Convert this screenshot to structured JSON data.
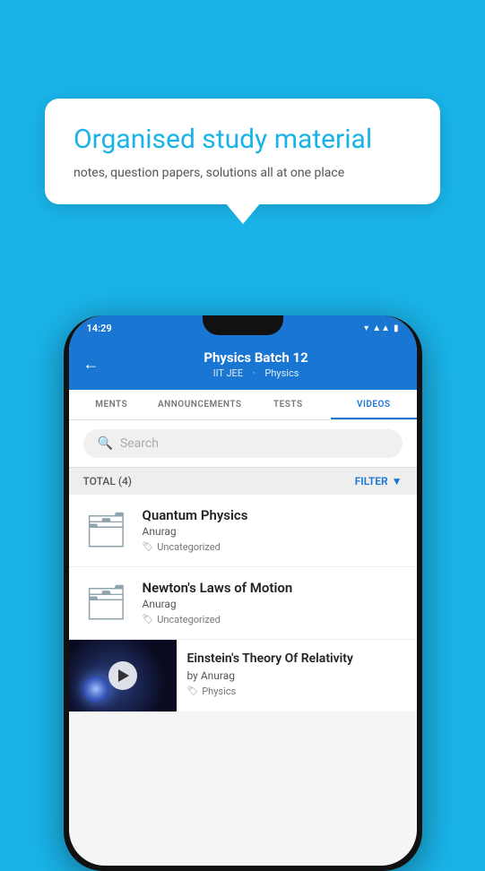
{
  "background_color": "#1ab3e8",
  "bubble": {
    "title": "Organised study material",
    "subtitle": "notes, question papers, solutions all at one place"
  },
  "phone": {
    "status_bar": {
      "time": "14:29",
      "icons": [
        "wifi",
        "signal",
        "battery"
      ]
    },
    "header": {
      "back_label": "←",
      "title": "Physics Batch 12",
      "subtitle_part1": "IIT JEE",
      "subtitle_part2": "Physics"
    },
    "tabs": [
      {
        "label": "MENTS",
        "active": false
      },
      {
        "label": "ANNOUNCEMENTS",
        "active": false
      },
      {
        "label": "TESTS",
        "active": false
      },
      {
        "label": "VIDEOS",
        "active": true
      }
    ],
    "search": {
      "placeholder": "Search"
    },
    "filter_bar": {
      "total_label": "TOTAL (4)",
      "filter_label": "FILTER"
    },
    "items": [
      {
        "type": "folder",
        "title": "Quantum Physics",
        "author": "Anurag",
        "tag": "Uncategorized"
      },
      {
        "type": "folder",
        "title": "Newton's Laws of Motion",
        "author": "Anurag",
        "tag": "Uncategorized"
      },
      {
        "type": "video",
        "title": "Einstein's Theory Of Relativity",
        "author": "by Anurag",
        "tag": "Physics"
      }
    ]
  }
}
